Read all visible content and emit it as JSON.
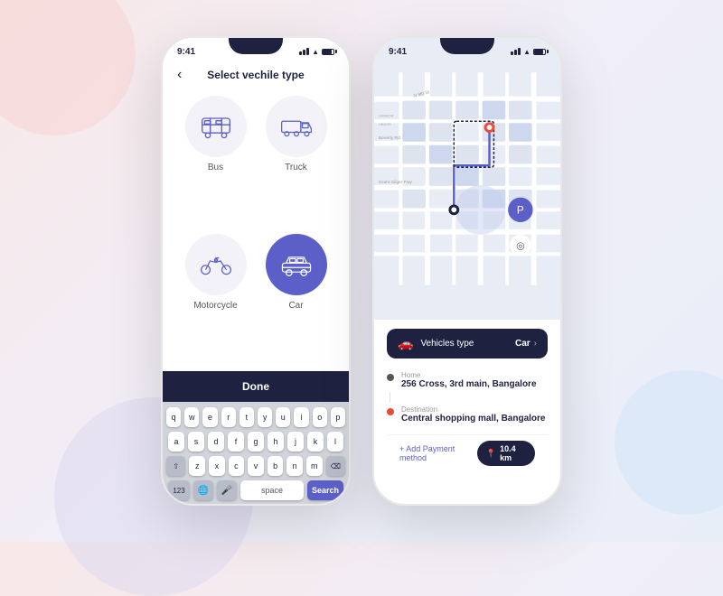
{
  "background": {
    "circle_pink": "bg-circle-pink",
    "circle_purple": "bg-circle-purple",
    "circle_blue": "bg-circle-blue"
  },
  "phone1": {
    "status_time": "9:41",
    "header_title": "Select vechile type",
    "back_label": "‹",
    "vehicles": [
      {
        "id": "bus",
        "label": "Bus",
        "selected": false
      },
      {
        "id": "truck",
        "label": "Truck",
        "selected": false
      },
      {
        "id": "motorcycle",
        "label": "Motorcycle",
        "selected": false
      },
      {
        "id": "car",
        "label": "Car",
        "selected": true
      }
    ],
    "done_label": "Done",
    "keyboard": {
      "row1": [
        "q",
        "w",
        "e",
        "r",
        "t",
        "y",
        "u",
        "i",
        "o",
        "p"
      ],
      "row2": [
        "a",
        "s",
        "d",
        "f",
        "g",
        "h",
        "j",
        "k",
        "l"
      ],
      "row3": [
        "z",
        "x",
        "c",
        "v",
        "b",
        "n",
        "m"
      ],
      "num_label": "123",
      "space_label": "space",
      "search_label": "Search"
    }
  },
  "phone2": {
    "status_time": "9:41",
    "vehicle_type_label": "Vehicles type",
    "vehicle_type_value": "Car",
    "home_sublabel": "Home",
    "home_address": "256 Cross, 3rd main, Bangalore",
    "dest_sublabel": "Destination",
    "dest_address": "Central shopping mall, Bangalore",
    "add_payment_label": "+ Add Payment method",
    "distance_label": "10.4 km"
  }
}
